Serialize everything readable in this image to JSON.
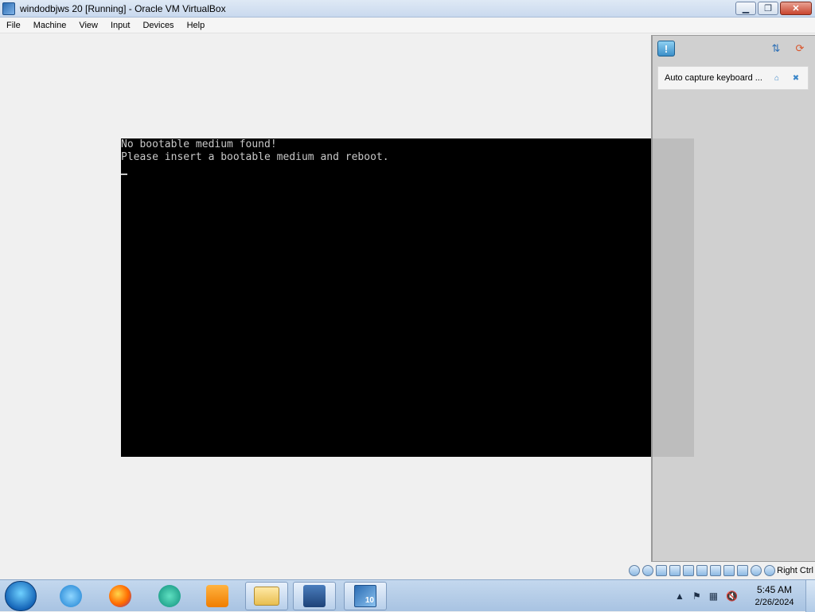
{
  "window": {
    "title": "windodbjws 20 [Running] - Oracle VM VirtualBox",
    "minimize_label": "▁",
    "restore_label": "❐",
    "close_label": "✕"
  },
  "menu": [
    "File",
    "Machine",
    "View",
    "Input",
    "Devices",
    "Help"
  ],
  "console": {
    "lines": [
      "No bootable medium found!",
      "Please insert a bootable medium and reboot."
    ]
  },
  "notification_panel": {
    "alert_icon_label": "!",
    "sort_icon_label": "⇅",
    "clear_icon_label": "⟳",
    "notice_text": "Auto capture keyboard ...",
    "notice_toggle_label": "⌂",
    "notice_close_label": "✖"
  },
  "statusbar": {
    "host_key_label": "Right Ctrl"
  },
  "taskbar": {
    "vm_badge": "10",
    "tray": {
      "up_arrow": "▲",
      "flag": "⚑",
      "network": "▦",
      "volume": "🔇"
    },
    "clock_time": "5:45 AM",
    "clock_date": "2/26/2024"
  }
}
